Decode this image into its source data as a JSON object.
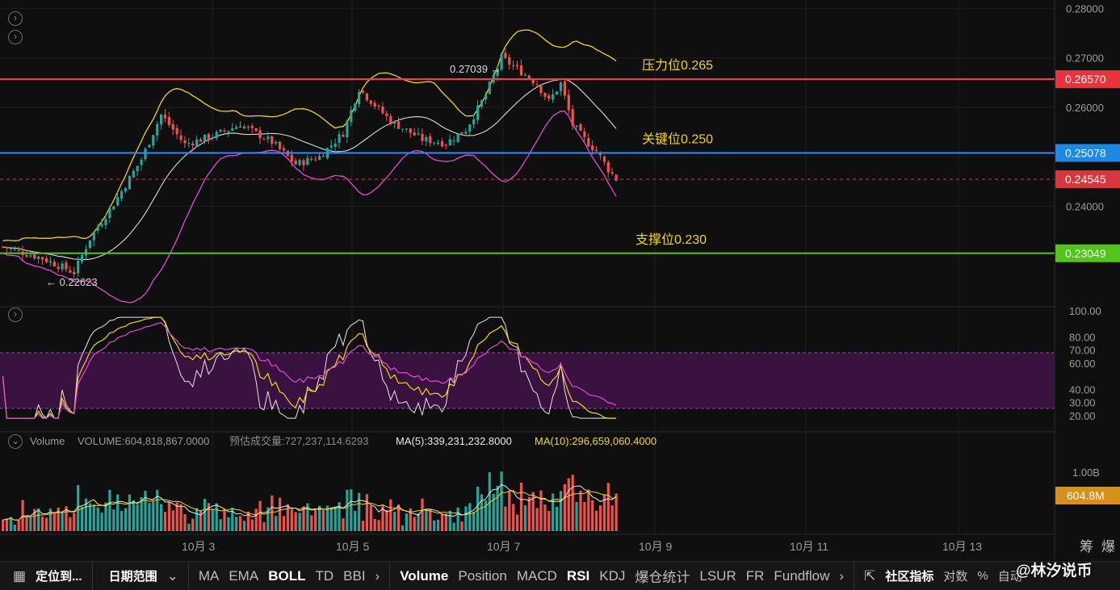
{
  "price_axis": {
    "ticks": [
      "0.28000",
      "0.27000",
      "0.26000",
      "0.25000",
      "0.24000"
    ],
    "tags": [
      {
        "text": "0.26570",
        "color": "#e8323c",
        "value": 0.2657
      },
      {
        "text": "0.25078",
        "color": "#1e88e5",
        "value": 0.25078
      },
      {
        "text": "0.24545",
        "color": "#d9363e",
        "value": 0.24545
      },
      {
        "text": "0.23049",
        "color": "#52c41a",
        "value": 0.23049
      }
    ]
  },
  "levels": [
    {
      "label": "压力位0.265",
      "value": 0.2657,
      "color": "#ff3b3b"
    },
    {
      "label": "关键位0.250",
      "value": 0.25078,
      "color": "#2f8bff"
    },
    {
      "label": "支撑位0.230",
      "value": 0.23049,
      "color": "#52c41a"
    }
  ],
  "annotations": {
    "high": "0.27039 →",
    "low": "← 0.22623"
  },
  "rsi": {
    "ticks": [
      "100.00",
      "80.00",
      "70.00",
      "60.00",
      "40.00",
      "30.00",
      "20.00"
    ],
    "overbought": 70,
    "oversold": 30
  },
  "volume": {
    "label": "Volume",
    "value": "VOLUME:604,818,867.0000",
    "estimate": "预估成交量:727,237,114.6293",
    "ma5": "MA(5):339,231,232.8000",
    "ma10": "MA(10):296,659,060.4000",
    "axis_tick": "1.00B",
    "tag": "604.8M"
  },
  "time_axis": [
    "10月 3",
    "10月 5",
    "10月 7",
    "10月 9",
    "10月 11",
    "10月 13"
  ],
  "corner_labels": {
    "chips": "筹",
    "liquidation": "爆"
  },
  "toolbar": {
    "goto": "定位到...",
    "date_range": "日期范围",
    "main_indicators": [
      "MA",
      "EMA",
      "BOLL",
      "TD",
      "BBI"
    ],
    "sub_indicators": [
      "Volume",
      "Position",
      "MACD",
      "RSI",
      "KDJ",
      "爆仓统计",
      "LSUR",
      "FR",
      "Fundflow"
    ],
    "community": "社区指标",
    "log": "对数",
    "percent": "%",
    "auto": "自动",
    "watermark": "@林汐说币"
  },
  "chart_data": {
    "type": "candlestick",
    "title": "",
    "price_range": [
      0.2205,
      0.2817
    ],
    "ohlc_points": [
      {
        "t": 0,
        "close": 0.2318
      },
      {
        "t": 10,
        "close": 0.2295
      },
      {
        "t": 18,
        "close": 0.2266
      },
      {
        "t": 22,
        "close": 0.2335
      },
      {
        "t": 28,
        "close": 0.2405
      },
      {
        "t": 35,
        "close": 0.2495
      },
      {
        "t": 40,
        "close": 0.2585
      },
      {
        "t": 46,
        "close": 0.2525
      },
      {
        "t": 54,
        "close": 0.2545
      },
      {
        "t": 60,
        "close": 0.2565
      },
      {
        "t": 68,
        "close": 0.253
      },
      {
        "t": 74,
        "close": 0.2485
      },
      {
        "t": 80,
        "close": 0.25
      },
      {
        "t": 86,
        "close": 0.2548
      },
      {
        "t": 90,
        "close": 0.2638
      },
      {
        "t": 98,
        "close": 0.2572
      },
      {
        "t": 106,
        "close": 0.2535
      },
      {
        "t": 112,
        "close": 0.2528
      },
      {
        "t": 117,
        "close": 0.2555
      },
      {
        "t": 122,
        "close": 0.2625
      },
      {
        "t": 126,
        "close": 0.27
      },
      {
        "t": 131,
        "close": 0.2672
      },
      {
        "t": 135,
        "close": 0.2648
      },
      {
        "t": 138,
        "close": 0.2612
      },
      {
        "t": 141,
        "close": 0.2648
      },
      {
        "t": 144,
        "close": 0.2565
      },
      {
        "t": 147,
        "close": 0.2535
      },
      {
        "t": 150,
        "close": 0.2512
      },
      {
        "t": 153,
        "close": 0.2475
      },
      {
        "t": 155,
        "close": 0.2455
      }
    ],
    "price_high": 0.27039,
    "price_low": 0.22623,
    "last_price": 0.24545,
    "rsi_range": [
      15,
      100
    ],
    "volume_scale_max": 1.3,
    "volume_unit": "B"
  }
}
